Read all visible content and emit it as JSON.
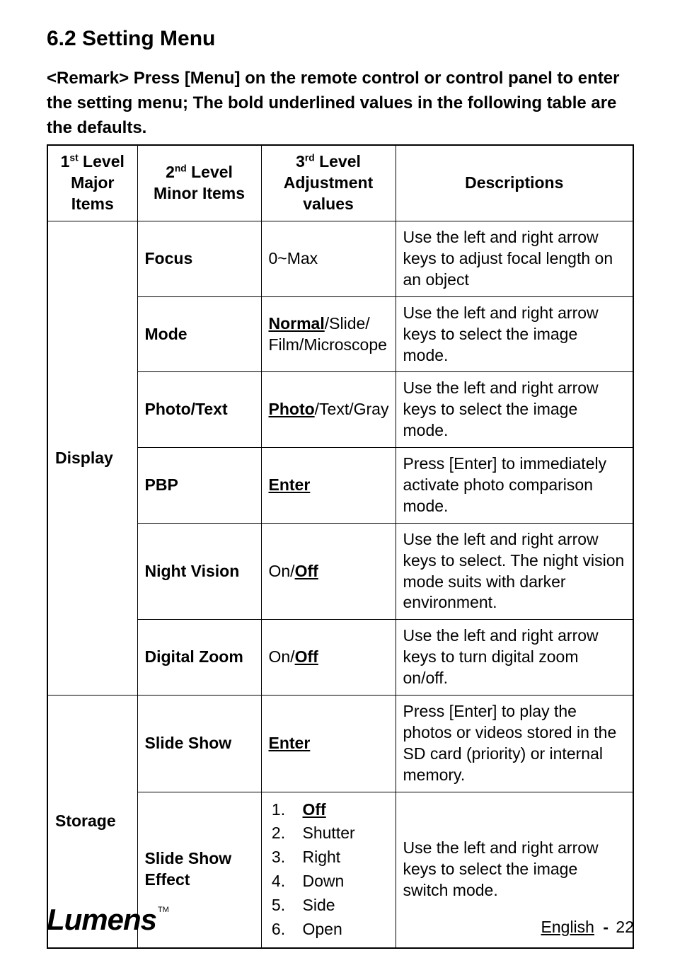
{
  "heading": "6.2 Setting Menu",
  "remark": "<Remark> Press [Menu] on the remote control or control panel to enter the setting menu; The bold underlined values in the following table are the defaults.",
  "table": {
    "headers": {
      "col0_pre": "1",
      "col0_sup": "st",
      "col0_post": " Level Major Items",
      "col1_pre": "2",
      "col1_sup": "nd",
      "col1_post": " Level Minor Items",
      "col2_pre": "3",
      "col2_sup": "rd",
      "col2_post": " Level Adjustment values",
      "col3": "Descriptions"
    },
    "groups": [
      {
        "major": "Display",
        "rows": [
          {
            "minor": "Focus",
            "adj_plain_pre": "0~Max",
            "adj_default": "",
            "adj_plain_post": "",
            "desc": "Use the left and right arrow keys to adjust focal length on an object"
          },
          {
            "minor": "Mode",
            "adj_plain_pre": "",
            "adj_default": "Normal",
            "adj_plain_post": "/Slide/ Film/Microscope",
            "desc": "Use the left and right arrow keys to select the image mode."
          },
          {
            "minor": "Photo/Text",
            "adj_plain_pre": "",
            "adj_default": "Photo",
            "adj_plain_post": "/Text/Gray",
            "desc": "Use the left and right arrow keys to select the image mode."
          },
          {
            "minor": "PBP",
            "adj_plain_pre": "",
            "adj_default": "Enter",
            "adj_plain_post": "",
            "desc": "Press [Enter] to immediately activate photo comparison mode."
          },
          {
            "minor": "Night Vision",
            "adj_plain_pre": "On/",
            "adj_default": "Off",
            "adj_plain_post": "",
            "desc": "Use the left and right arrow keys to select. The night vision mode suits with darker environment."
          },
          {
            "minor": "Digital Zoom",
            "adj_plain_pre": "On/",
            "adj_default": "Off",
            "adj_plain_post": "",
            "desc": "Use the left and right arrow keys to turn digital zoom on/off."
          }
        ]
      },
      {
        "major": "Storage",
        "rows": [
          {
            "minor": "Slide Show",
            "adj_plain_pre": "",
            "adj_default": "Enter",
            "adj_plain_post": "",
            "desc": "Press [Enter] to play the photos or videos stored in the SD card (priority) or internal memory."
          },
          {
            "minor": "Slide Show Effect",
            "adj_options": [
              {
                "default": true,
                "label": "Off"
              },
              {
                "default": false,
                "label": "Shutter"
              },
              {
                "default": false,
                "label": "Right"
              },
              {
                "default": false,
                "label": "Down"
              },
              {
                "default": false,
                "label": "Side"
              },
              {
                "default": false,
                "label": "Open"
              }
            ],
            "desc": "Use the left and right arrow keys to select the image switch mode."
          }
        ]
      }
    ]
  },
  "footer": {
    "logo": "Lumens",
    "logo_tm": "TM",
    "language": "English",
    "page": "22"
  }
}
